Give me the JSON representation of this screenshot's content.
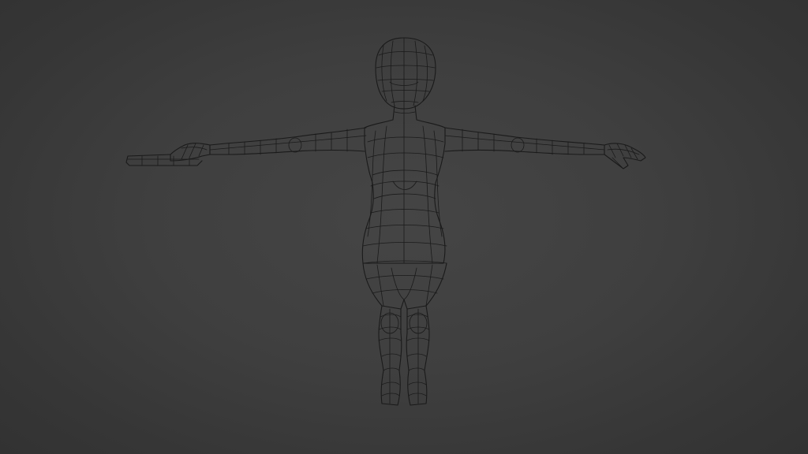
{
  "viewport": {
    "background": "#3f3f3f",
    "wire_color": "#1a1a1a",
    "shading": "wireframe",
    "object_pose": "T-pose"
  }
}
